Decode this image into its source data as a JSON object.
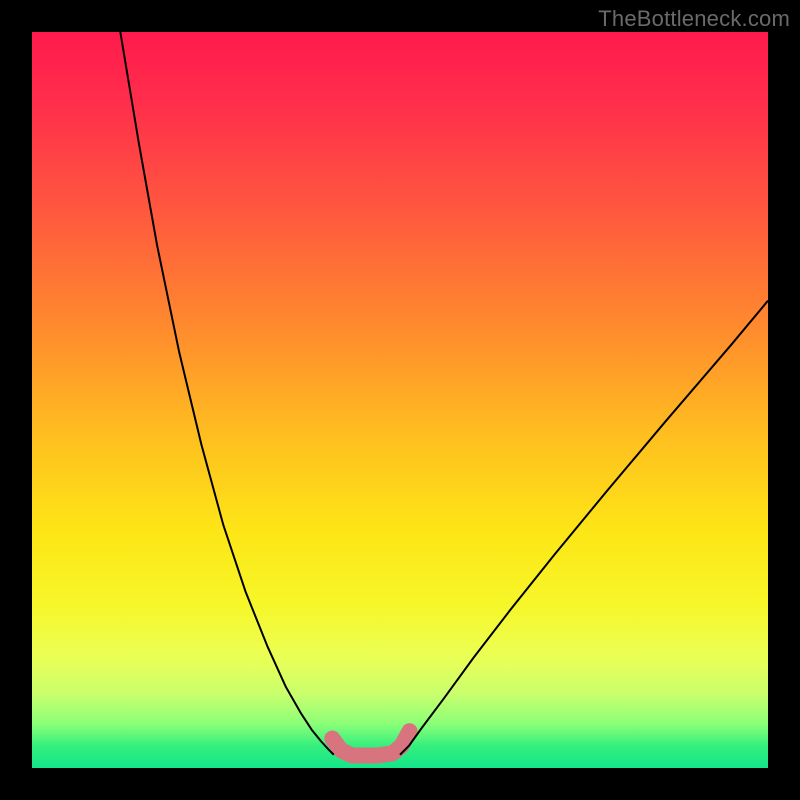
{
  "watermark": {
    "text": "TheBottleneck.com"
  },
  "chart_data": {
    "type": "line",
    "title": "",
    "xlabel": "",
    "ylabel": "",
    "xlim": [
      0,
      100
    ],
    "ylim": [
      100,
      0
    ],
    "grid": false,
    "legend": false,
    "background": {
      "type": "vertical-gradient",
      "stops": [
        {
          "offset": 0.0,
          "color": "#ff1a4d"
        },
        {
          "offset": 0.1,
          "color": "#ff2f4b"
        },
        {
          "offset": 0.25,
          "color": "#ff5a3e"
        },
        {
          "offset": 0.4,
          "color": "#ff8a2e"
        },
        {
          "offset": 0.55,
          "color": "#ffbf1f"
        },
        {
          "offset": 0.68,
          "color": "#fde616"
        },
        {
          "offset": 0.78,
          "color": "#f6f72a"
        },
        {
          "offset": 0.85,
          "color": "#eaff55"
        },
        {
          "offset": 0.9,
          "color": "#c9ff6d"
        },
        {
          "offset": 0.94,
          "color": "#8bff78"
        },
        {
          "offset": 0.97,
          "color": "#35ef7d"
        },
        {
          "offset": 1.0,
          "color": "#13e58a"
        }
      ]
    },
    "series": [
      {
        "name": "left-curve",
        "type": "line",
        "color": "#000000",
        "width": 2,
        "x": [
          12.0,
          14.5,
          17.0,
          20.0,
          23.0,
          26.0,
          29.0,
          32.0,
          34.5,
          36.5,
          38.0,
          39.3,
          40.3,
          41.0
        ],
        "y": [
          100.0,
          85.0,
          71.0,
          56.5,
          44.0,
          33.0,
          24.0,
          16.5,
          11.0,
          7.5,
          5.2,
          3.6,
          2.5,
          1.8
        ]
      },
      {
        "name": "right-curve",
        "type": "line",
        "color": "#000000",
        "width": 2,
        "x": [
          50.0,
          51.2,
          53.0,
          56.0,
          60.0,
          65.0,
          71.0,
          78.0,
          86.0,
          95.0,
          100.0
        ],
        "y": [
          1.8,
          3.0,
          5.5,
          9.5,
          15.0,
          21.5,
          29.0,
          37.5,
          47.0,
          57.5,
          63.5
        ]
      },
      {
        "name": "trough-highlight",
        "type": "line",
        "color": "#d8747e",
        "width": 16,
        "linecap": "round",
        "x": [
          40.8,
          42.0,
          43.5,
          47.0,
          49.0,
          50.2,
          51.3
        ],
        "y": [
          4.0,
          2.4,
          1.7,
          1.7,
          2.0,
          3.0,
          5.0
        ]
      }
    ]
  }
}
